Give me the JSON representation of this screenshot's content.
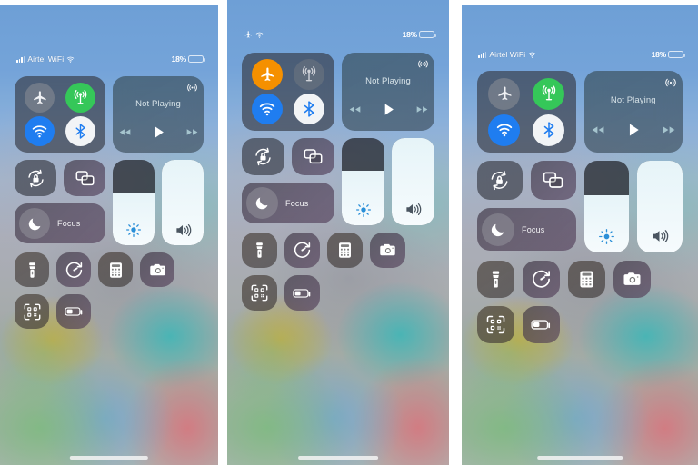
{
  "meta": {
    "screen_title": "iOS Control Center",
    "panel_count": 3
  },
  "colors": {
    "green_on": "#35c759",
    "blue_on": "#1f7df0",
    "orange_on": "#f59000",
    "white_on": "#f2f4f6",
    "gray_off": "#8c8e96",
    "battery_red": "#f03b2e"
  },
  "panels": [
    {
      "id": "panel-1",
      "status_bar": {
        "mode": "carrier",
        "signal_icon": "cellular-bars-icon",
        "carrier": "Airtel WiFi",
        "wifi_icon": "wifi-icon",
        "battery_percent": "18%",
        "battery_icon": "battery-low-icon",
        "battery_fill": 22
      },
      "connectivity": {
        "airplane": {
          "label": "Airplane Mode",
          "icon": "airplane-icon",
          "state": "off",
          "color": "#8c8e96"
        },
        "cellular": {
          "label": "Cellular Data",
          "icon": "cellular-antenna-icon",
          "state": "on",
          "color": "#35c759"
        },
        "wifi": {
          "label": "Wi-Fi",
          "icon": "wifi-icon",
          "state": "on",
          "color": "#1f7df0"
        },
        "bluetooth": {
          "label": "Bluetooth",
          "icon": "bluetooth-icon",
          "state": "on",
          "color": "#f2f4f6"
        }
      },
      "media": {
        "title": "Not Playing",
        "airplay_icon": "airplay-audio-icon",
        "rewind_icon": "rewind-icon",
        "play_icon": "play-icon",
        "forward_icon": "fast-forward-icon"
      },
      "rotation_lock": {
        "label": "Rotation Lock",
        "icon": "rotation-lock-icon",
        "state": "off"
      },
      "screen_mirroring": {
        "label": "Screen Mirroring",
        "icon": "screen-mirroring-icon",
        "state": "off"
      },
      "focus": {
        "label": "Focus",
        "icon": "moon-icon",
        "state": "off"
      },
      "brightness": {
        "label": "Display Brightness",
        "icon": "brightness-sun-icon",
        "value": 62
      },
      "volume": {
        "label": "Volume",
        "icon": "speaker-volume-icon",
        "value": 100
      },
      "tiles": [
        {
          "label": "Flashlight",
          "icon": "flashlight-icon"
        },
        {
          "label": "Timer",
          "icon": "timer-icon"
        },
        {
          "label": "Calculator",
          "icon": "calculator-icon"
        },
        {
          "label": "Camera",
          "icon": "camera-icon"
        },
        {
          "label": "Code Scanner",
          "icon": "qr-code-scanner-icon"
        },
        {
          "label": "Low Power Mode",
          "icon": "battery-low-power-icon"
        }
      ],
      "home_indicator": "home-indicator"
    },
    {
      "id": "panel-2",
      "status_bar": {
        "mode": "airplane",
        "airplane_icon": "airplane-icon",
        "carrier": "",
        "wifi_icon": "wifi-icon",
        "battery_percent": "18%",
        "battery_icon": "battery-low-icon",
        "battery_fill": 22
      },
      "connectivity": {
        "airplane": {
          "label": "Airplane Mode",
          "icon": "airplane-icon",
          "state": "on",
          "color": "#f59000"
        },
        "cellular": {
          "label": "Cellular Data",
          "icon": "cellular-antenna-icon",
          "state": "off",
          "color": "#8c8e96"
        },
        "wifi": {
          "label": "Wi-Fi",
          "icon": "wifi-icon",
          "state": "on",
          "color": "#1f7df0"
        },
        "bluetooth": {
          "label": "Bluetooth",
          "icon": "bluetooth-icon",
          "state": "on",
          "color": "#f2f4f6"
        }
      },
      "media": {
        "title": "Not Playing",
        "airplay_icon": "airplay-audio-icon",
        "rewind_icon": "rewind-icon",
        "play_icon": "play-icon",
        "forward_icon": "fast-forward-icon"
      },
      "rotation_lock": {
        "label": "Rotation Lock",
        "icon": "rotation-lock-icon",
        "state": "off"
      },
      "screen_mirroring": {
        "label": "Screen Mirroring",
        "icon": "screen-mirroring-icon",
        "state": "off"
      },
      "focus": {
        "label": "Focus",
        "icon": "moon-icon",
        "state": "off"
      },
      "brightness": {
        "label": "Display Brightness",
        "icon": "brightness-sun-icon",
        "value": 62
      },
      "volume": {
        "label": "Volume",
        "icon": "speaker-volume-icon",
        "value": 100
      },
      "tiles": [
        {
          "label": "Flashlight",
          "icon": "flashlight-icon"
        },
        {
          "label": "Timer",
          "icon": "timer-icon"
        },
        {
          "label": "Calculator",
          "icon": "calculator-icon"
        },
        {
          "label": "Camera",
          "icon": "camera-icon"
        },
        {
          "label": "Code Scanner",
          "icon": "qr-code-scanner-icon"
        },
        {
          "label": "Low Power Mode",
          "icon": "battery-low-power-icon"
        }
      ],
      "home_indicator": "home-indicator"
    },
    {
      "id": "panel-3",
      "status_bar": {
        "mode": "carrier",
        "signal_icon": "cellular-bars-icon",
        "carrier": "Airtel WiFi",
        "wifi_icon": "wifi-icon",
        "battery_percent": "18%",
        "battery_icon": "battery-low-icon",
        "battery_fill": 22
      },
      "connectivity": {
        "airplane": {
          "label": "Airplane Mode",
          "icon": "airplane-icon",
          "state": "off",
          "color": "#8c8e96"
        },
        "cellular": {
          "label": "Cellular Data",
          "icon": "cellular-antenna-icon",
          "state": "on",
          "color": "#35c759"
        },
        "wifi": {
          "label": "Wi-Fi",
          "icon": "wifi-icon",
          "state": "on",
          "color": "#1f7df0"
        },
        "bluetooth": {
          "label": "Bluetooth",
          "icon": "bluetooth-icon",
          "state": "on",
          "color": "#f2f4f6"
        }
      },
      "media": {
        "title": "Not Playing",
        "airplay_icon": "airplay-audio-icon",
        "rewind_icon": "rewind-icon",
        "play_icon": "play-icon",
        "forward_icon": "fast-forward-icon"
      },
      "rotation_lock": {
        "label": "Rotation Lock",
        "icon": "rotation-lock-icon",
        "state": "off"
      },
      "screen_mirroring": {
        "label": "Screen Mirroring",
        "icon": "screen-mirroring-icon",
        "state": "off"
      },
      "focus": {
        "label": "Focus",
        "icon": "moon-icon",
        "state": "off"
      },
      "brightness": {
        "label": "Display Brightness",
        "icon": "brightness-sun-icon",
        "value": 62
      },
      "volume": {
        "label": "Volume",
        "icon": "speaker-volume-icon",
        "value": 100
      },
      "tiles": [
        {
          "label": "Flashlight",
          "icon": "flashlight-icon"
        },
        {
          "label": "Timer",
          "icon": "timer-icon"
        },
        {
          "label": "Calculator",
          "icon": "calculator-icon"
        },
        {
          "label": "Camera",
          "icon": "camera-icon"
        },
        {
          "label": "Code Scanner",
          "icon": "qr-code-scanner-icon"
        },
        {
          "label": "Low Power Mode",
          "icon": "battery-low-power-icon"
        }
      ],
      "home_indicator": "home-indicator"
    }
  ]
}
